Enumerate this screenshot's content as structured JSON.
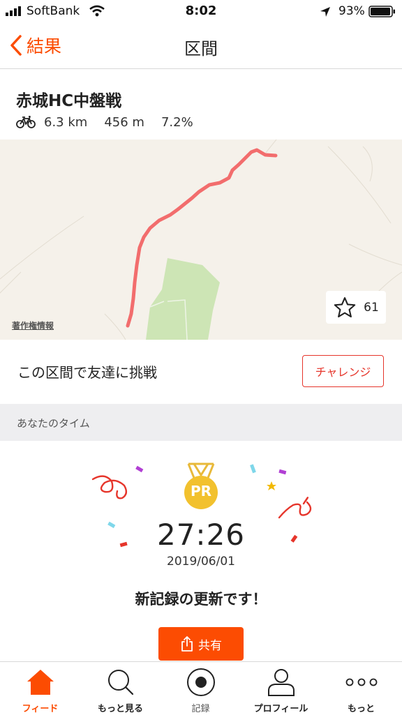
{
  "status_bar": {
    "carrier": "SoftBank",
    "time": "8:02",
    "battery": "93%"
  },
  "nav": {
    "back_label": "結果",
    "title": "区間"
  },
  "segment": {
    "name": "赤城HC中盤戦",
    "distance": "6.3 km",
    "elevation": "456 m",
    "grade": "7.2%"
  },
  "map": {
    "credit": "著作権情報",
    "star_count": "61"
  },
  "challenge": {
    "text": "この区間で友達に挑戦",
    "button": "チャレンジ"
  },
  "your_time": {
    "header": "あなたのタイム",
    "badge": "PR",
    "time": "27:26",
    "date": "2019/06/01",
    "message": "新記録の更新です！",
    "share_label": "共有"
  },
  "tabs": [
    {
      "label": "フィード",
      "icon": "home-icon",
      "active": true
    },
    {
      "label": "もっと見る",
      "icon": "search-icon"
    },
    {
      "label": "記録",
      "icon": "record-icon"
    },
    {
      "label": "プロフィール",
      "icon": "profile-icon"
    },
    {
      "label": "もっと",
      "icon": "more-icon"
    }
  ],
  "colors": {
    "accent": "#fc4c02",
    "route": "#f26d6d",
    "challenge": "#e6352b",
    "park": "#cde5b5"
  }
}
